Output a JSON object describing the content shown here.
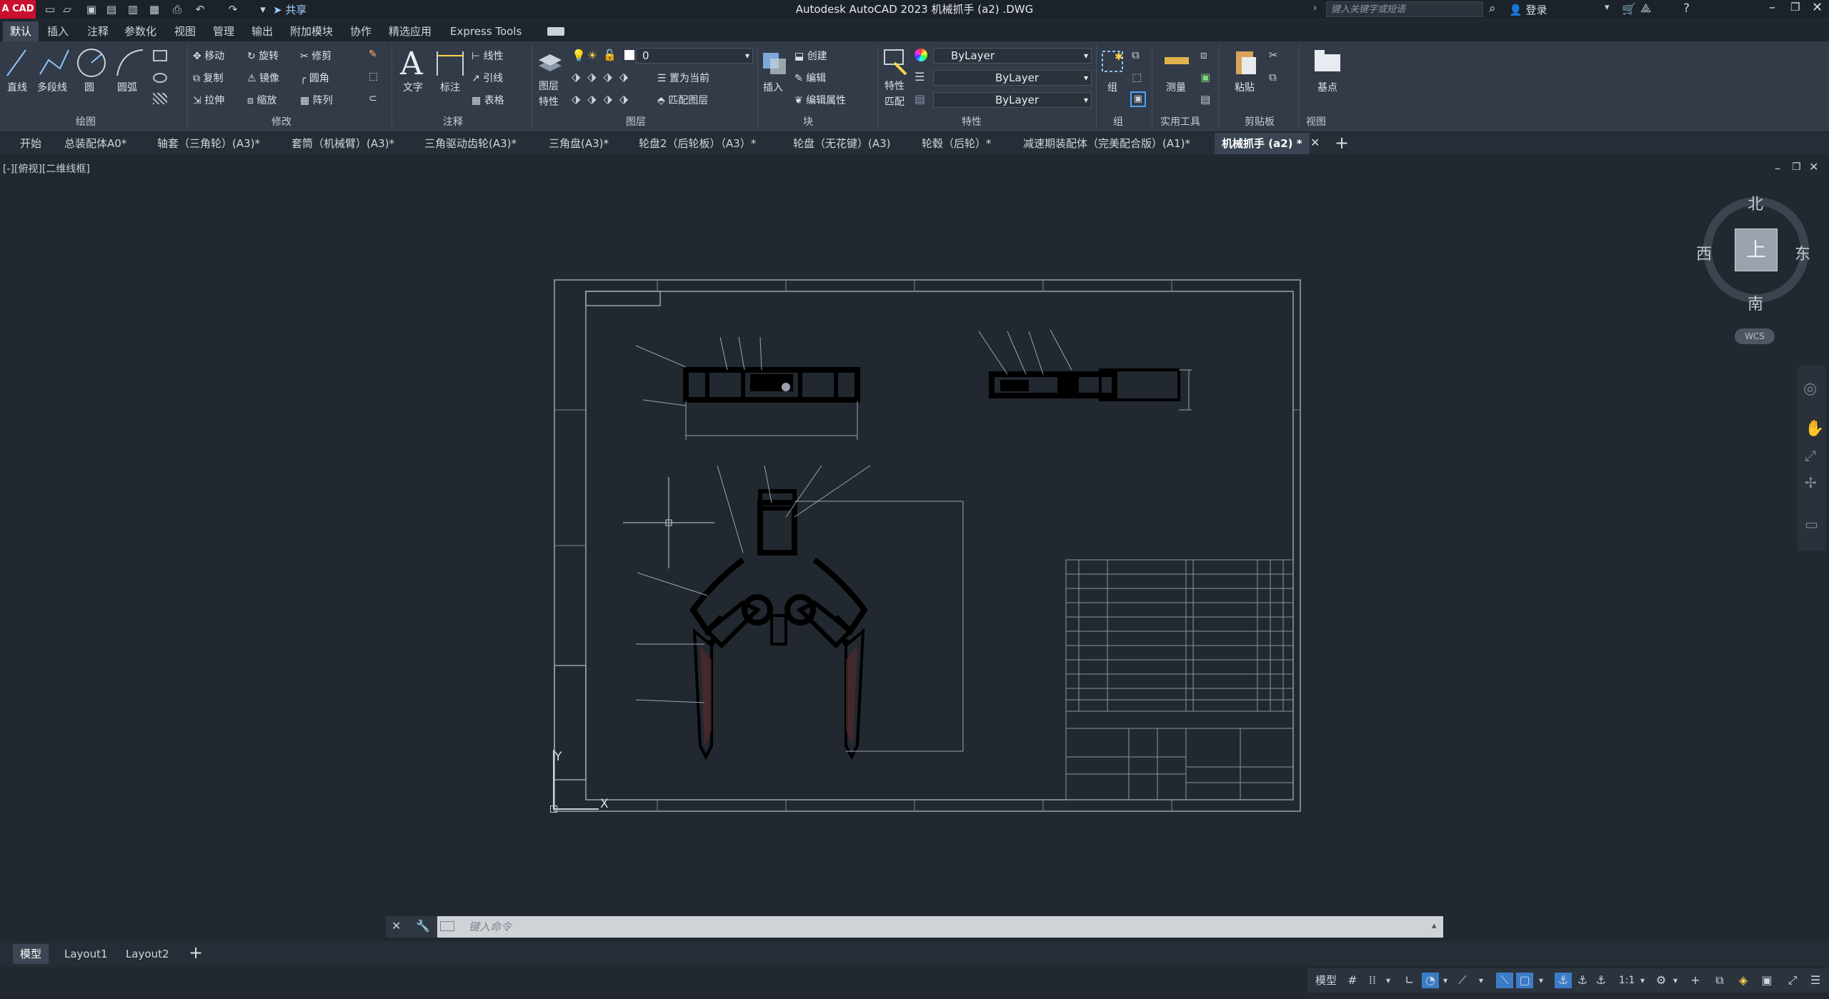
{
  "app": {
    "logo": "A CAD",
    "title": "Autodesk AutoCAD 2023   机械抓手  (a2)  .DWG",
    "search_placeholder": "键入关键字或短语",
    "login": "登录",
    "share": "共享"
  },
  "ribbon_tabs": [
    "默认",
    "插入",
    "注释",
    "参数化",
    "视图",
    "管理",
    "输出",
    "附加模块",
    "协作",
    "精选应用",
    "Express Tools"
  ],
  "ribbon": {
    "draw": {
      "line": "直线",
      "polyline": "多段线",
      "circle": "圆",
      "arc": "圆弧",
      "panel": "绘图"
    },
    "modify": {
      "move": "移动",
      "rotate": "旋转",
      "trim": "修剪",
      "copy": "复制",
      "mirror": "镜像",
      "fillet": "圆角",
      "stretch": "拉伸",
      "scale": "缩放",
      "array": "阵列",
      "panel": "修改"
    },
    "annotation": {
      "text": "文字",
      "dimension": "标注",
      "linear": "线性",
      "leader": "引线",
      "table": "表格",
      "panel": "注释"
    },
    "layers": {
      "layer_props": "图层",
      "layer_props2": "特性",
      "current_layer": "0",
      "make_current": "置为当前",
      "match_layer": "匹配图层",
      "panel": "图层"
    },
    "block": {
      "insert": "插入",
      "create": "创建",
      "edit": "编辑",
      "edit_attr": "编辑属性",
      "panel": "块"
    },
    "properties": {
      "match": "特性",
      "match2": "匹配",
      "color": "ByLayer",
      "linetype": "ByLayer",
      "lineweight": "ByLayer",
      "panel": "特性"
    },
    "groups": {
      "group": "组",
      "panel": "组"
    },
    "utilities": {
      "measure": "测量",
      "panel": "实用工具"
    },
    "clipboard": {
      "paste": "粘贴",
      "panel": "剪贴板"
    },
    "view": {
      "base": "基点",
      "panel": "视图"
    }
  },
  "file_tabs": [
    "开始",
    "总装配体A0*",
    "轴套（三角轮）(A3)*",
    "套筒（机械臂）(A3)*",
    "三角驱动齿轮(A3)*",
    "三角盘(A3)*",
    "轮盘2（后轮板）（A3）*",
    "轮盘（无花键）(A3)",
    "轮毂（后轮）*",
    "减速期装配体（完美配合版）(A1)*",
    "机械抓手 (a2) *"
  ],
  "viewport": {
    "label": "[-][俯视][二维线框]",
    "compass": {
      "north": "北",
      "south": "南",
      "east": "东",
      "west": "西",
      "top": "上"
    },
    "wcs": "WCS",
    "ucs_y": "Y",
    "ucs_x": "X"
  },
  "command": {
    "placeholder": "键入命令"
  },
  "layout_tabs": [
    "模型",
    "Layout1",
    "Layout2"
  ],
  "status": {
    "model": "模型",
    "scale": "1:1"
  }
}
